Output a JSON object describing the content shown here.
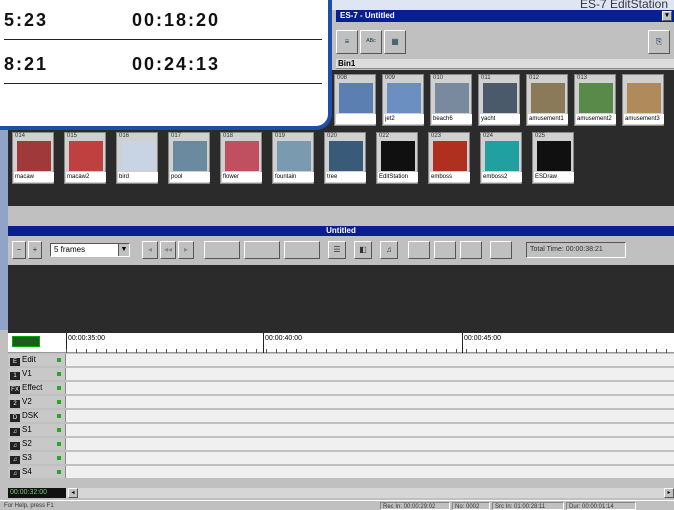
{
  "app": {
    "brand": "ES-7 EditStation",
    "window_title": "ES-7 - Untitled",
    "bin_title": "Bin1"
  },
  "callout": {
    "rows": [
      {
        "left": "5:23",
        "right": "00:18:20"
      },
      {
        "left": "8:21",
        "right": "00:24:13"
      }
    ]
  },
  "bin": {
    "row1": [
      {
        "num": "008",
        "label": "",
        "color": "#5a7fb0"
      },
      {
        "num": "009",
        "label": "jet2",
        "color": "#6b8fc0"
      },
      {
        "num": "010",
        "label": "beach6",
        "color": "#7a8a9e"
      },
      {
        "num": "011",
        "label": "yacht",
        "color": "#4a5a6a"
      },
      {
        "num": "012",
        "label": "amusement1",
        "color": "#8a7a5a"
      },
      {
        "num": "013",
        "label": "amusement2",
        "color": "#5a8a4a"
      },
      {
        "num": "",
        "label": "amusement3",
        "color": "#b08a5a"
      }
    ],
    "row2": [
      {
        "num": "014",
        "label": "macaw",
        "color": "#a03a3a"
      },
      {
        "num": "015",
        "label": "macaw2",
        "color": "#c04040"
      },
      {
        "num": "016",
        "label": "bird",
        "color": "#c8d4e4"
      },
      {
        "num": "017",
        "label": "pool",
        "color": "#6a8aa0"
      },
      {
        "num": "018",
        "label": "flower",
        "color": "#c05060"
      },
      {
        "num": "019",
        "label": "fountain",
        "color": "#7a9ab0"
      },
      {
        "num": "020",
        "label": "tree",
        "color": "#3a5a7a"
      },
      {
        "num": "022",
        "label": "EditStation",
        "color": "#101010"
      },
      {
        "num": "023",
        "label": "emboss",
        "color": "#b03020"
      },
      {
        "num": "024",
        "label": "emboss2",
        "color": "#20a0a0"
      },
      {
        "num": "025",
        "label": "ESDraw",
        "color": "#101010"
      }
    ]
  },
  "timeline": {
    "title": "Untitled",
    "frames_value": "5 frames",
    "total_time": "Total Time: 00:00:38:21",
    "ruler_labels": [
      "00:00:35:00",
      "00:00:40:00",
      "00:00:45:00"
    ],
    "current_timecode": "00:00:32:00",
    "tracks": [
      {
        "name": "Edit",
        "icon": "E"
      },
      {
        "name": "V1",
        "icon": "1"
      },
      {
        "name": "Effect",
        "icon": "FX"
      },
      {
        "name": "V2",
        "icon": "2"
      },
      {
        "name": "DSK",
        "icon": "D"
      },
      {
        "name": "S1",
        "icon": "♫"
      },
      {
        "name": "S2",
        "icon": "♫"
      },
      {
        "name": "S3",
        "icon": "♫"
      },
      {
        "name": "S4",
        "icon": "♫"
      }
    ]
  },
  "status": {
    "left": "For Help, press F1",
    "rec_in": "Rec In: 00:00:29:02",
    "no": "No: 0002",
    "src_in": "Src In: 01:00:28:11",
    "dur": "Dur: 00:00:01:14"
  }
}
